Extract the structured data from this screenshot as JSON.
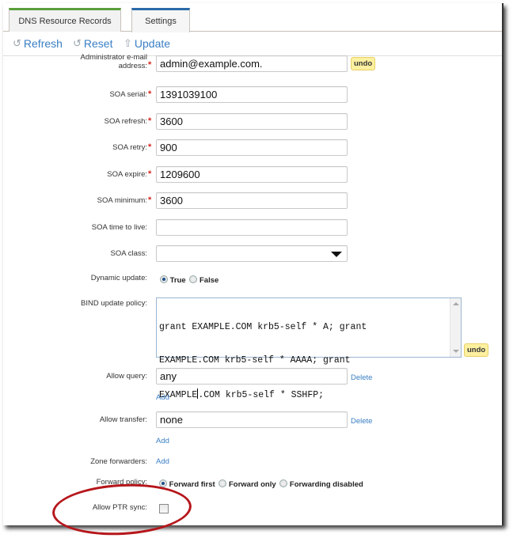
{
  "tabs": [
    {
      "label": "DNS Resource Records",
      "accent": "#5a9e3c",
      "active": false
    },
    {
      "label": "Settings",
      "accent": "#2a6aa9",
      "active": true
    }
  ],
  "toolbar": {
    "refresh_label": "Refresh",
    "reset_label": "Reset",
    "update_label": "Update"
  },
  "form": {
    "admin_email": {
      "label_line1": "Administrator e-mail",
      "label_line2": "address:",
      "required": true,
      "value": "admin@example.com.",
      "undo": "undo"
    },
    "soa_serial": {
      "label": "SOA serial:",
      "required": true,
      "value": "1391039100"
    },
    "soa_refresh": {
      "label": "SOA refresh:",
      "required": true,
      "value": "3600"
    },
    "soa_retry": {
      "label": "SOA retry:",
      "required": true,
      "value": "900"
    },
    "soa_expire": {
      "label": "SOA expire:",
      "required": true,
      "value": "1209600"
    },
    "soa_minimum": {
      "label": "SOA minimum:",
      "required": true,
      "value": "3600"
    },
    "soa_ttl": {
      "label": "SOA time to live:",
      "value": ""
    },
    "soa_class": {
      "label": "SOA class:",
      "value": ""
    },
    "dynamic_update": {
      "label": "Dynamic update:",
      "options": [
        "True",
        "False"
      ],
      "selected": "True"
    },
    "bind_policy": {
      "label": "BIND update policy:",
      "line1": "grant EXAMPLE.COM krb5-self * A; grant",
      "line2": "EXAMPLE.COM krb5-self * AAAA; grant",
      "line3a": "EXAMPLE",
      "line3b": ".COM krb5-self * SSHFP;",
      "undo": "undo"
    },
    "allow_query": {
      "label": "Allow query:",
      "value": "any",
      "delete": "Delete",
      "add": "Add"
    },
    "allow_transfer": {
      "label": "Allow transfer:",
      "value": "none",
      "delete": "Delete",
      "add": "Add"
    },
    "zone_forwarders": {
      "label": "Zone forwarders:",
      "add": "Add"
    },
    "forward_policy": {
      "label": "Forward policy:",
      "options": [
        "Forward first",
        "Forward only",
        "Forwarding disabled"
      ],
      "selected": "Forward first"
    },
    "allow_ptr_sync": {
      "label": "Allow PTR sync:",
      "checked": false
    }
  },
  "colors": {
    "link": "#3a7fc4",
    "required": "#d9261c",
    "undo_bg": "#fdf0a0",
    "annotation": "#b5161b"
  }
}
